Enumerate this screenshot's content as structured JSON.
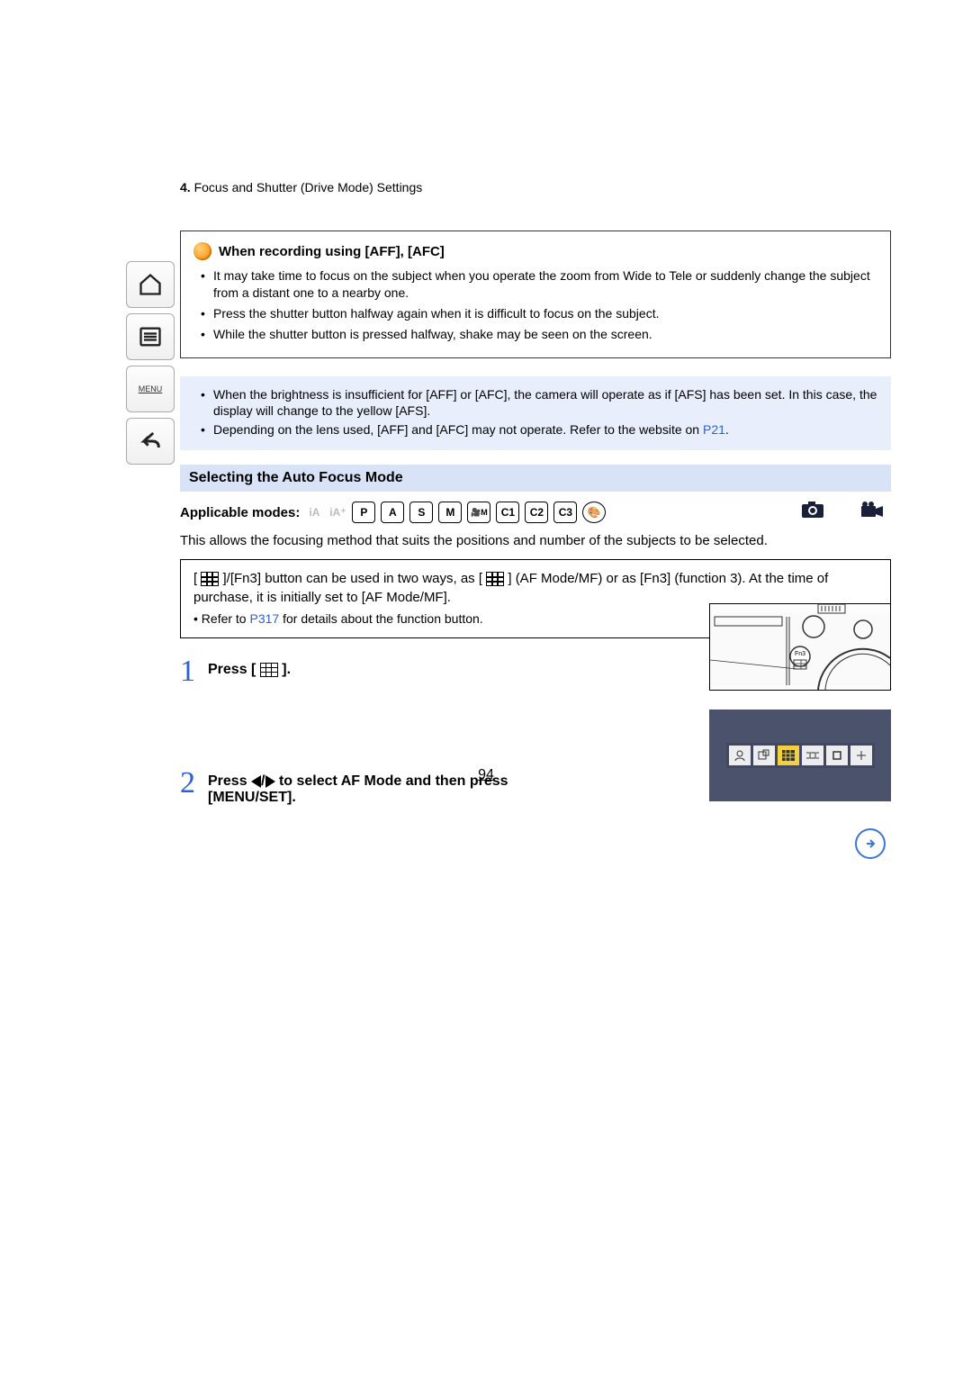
{
  "header": {
    "chapter_num": "4.",
    "chapter_title": "Focus and Shutter (Drive Mode) Settings"
  },
  "sidebar": {
    "menu_label": "MENU"
  },
  "note_box": {
    "title": "When recording using [AFF], [AFC]",
    "items": [
      "It may take time to focus on the subject when you operate the zoom from Wide to Tele or suddenly change the subject from a distant one to a nearby one.",
      "Press the shutter button halfway again when it is difficult to focus on the subject.",
      "While the shutter button is pressed halfway, shake may be seen on the screen."
    ]
  },
  "blue_box": {
    "item1": "When the brightness is insufficient for [AFF] or [AFC], the camera will operate as if [AFS] has been set. In this case, the display will change to the yellow [AFS].",
    "item2_pre": "Depending on the lens used, [AFF] and [AFC] may not operate. Refer to the website on ",
    "item2_link": "P21",
    "item2_post": "."
  },
  "section": {
    "heading": "Selecting the Auto Focus Mode",
    "applicable_label": "Applicable modes:",
    "modes": [
      "iA",
      "iA+",
      "P",
      "A",
      "S",
      "M",
      "🎥M",
      "C1",
      "C2",
      "C3",
      "🎨"
    ],
    "body": "This allows the focusing method that suits the positions and number of the subjects to be selected."
  },
  "fn_box": {
    "line1_pre": "[ ",
    "line1_mid1": " ]/[Fn3] button can be used in two ways, as [ ",
    "line1_mid2": " ] (AF Mode/MF) or as [Fn3] (function 3). At the time of purchase, it is initially set to [AF Mode/MF].",
    "sub_pre": "Refer to ",
    "sub_link": "P317",
    "sub_post": " for details about the function button."
  },
  "steps": {
    "s1_num": "1",
    "s1_pre": "Press [ ",
    "s1_post": " ].",
    "s2_num": "2",
    "s2_pre": "Press ",
    "s2_mid": " to select AF Mode and then press [MENU/SET].",
    "fn3_label": "Fn3"
  },
  "page_number": "94"
}
